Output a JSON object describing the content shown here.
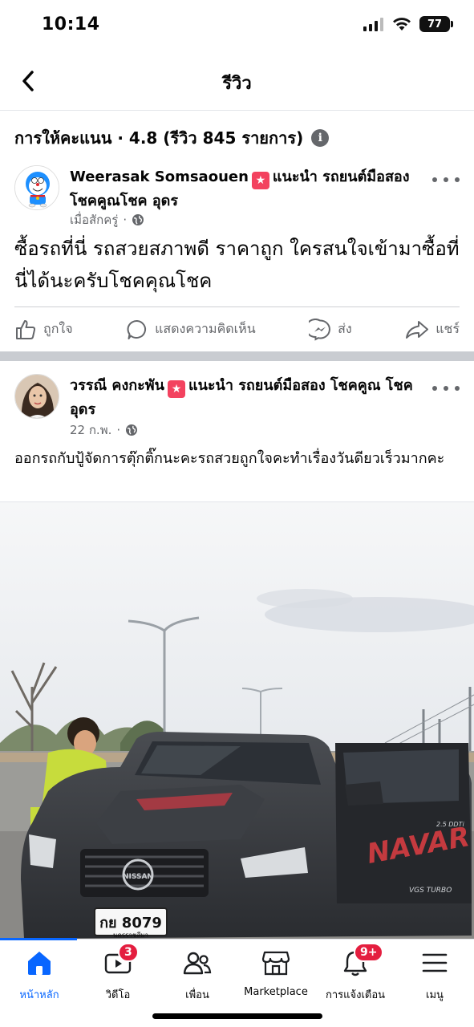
{
  "status_bar": {
    "time": "10:14",
    "battery": "77"
  },
  "header": {
    "title": "รีวิว"
  },
  "rating": {
    "summary": "การให้คะแนน · 4.8 (รีวิว 845 รายการ)"
  },
  "posts": [
    {
      "author": "Weerasak Somsaouen",
      "recommend_text": "แนะนำ รถยนต์มือสอง โชคคูณโชค อุดร",
      "time": "เมื่อสักครู่",
      "body": "ซื้อรถที่นี่ รถสวยสภาพดี ราคาถูก ใครสนใจเข้ามาซื้อที่นี่ได้นะครับโชคคุณโชค",
      "actions": {
        "like": "ถูกใจ",
        "comment": "แสดงความคิดเห็น",
        "send": "ส่ง",
        "share": "แชร์"
      }
    },
    {
      "author": "วรรณี คงกะพัน",
      "recommend_text": "แนะนำ รถยนต์มือสอง โชคคูณ โชค อุดร",
      "time": "22 ก.พ.",
      "body": "ออกรถกับปู้จัดการตุ๊กติ๊กนะคะรถสวยถูกใจคะทำเรื่องวันดียวเร็วมากคะ",
      "photo": {
        "plate": "กย 8079",
        "plate_sub": "นครราชสีมา",
        "brand": "NISSAN",
        "door_text": "NAVAR",
        "door_sub1": "2.5 DDTi",
        "door_sub2": "VGS TURBO"
      }
    }
  ],
  "bottom_nav": {
    "items": [
      {
        "label": "หน้าหลัก"
      },
      {
        "label": "วิดีโอ",
        "badge": "3"
      },
      {
        "label": "เพื่อน"
      },
      {
        "label": "Marketplace"
      },
      {
        "label": "การแจ้งเตือน",
        "badge": "9+"
      },
      {
        "label": "เมนู"
      }
    ]
  },
  "colors": {
    "accent": "#0866ff",
    "badge": "#e41e3f",
    "star_badge": "#f3425f",
    "muted": "#65676b"
  }
}
